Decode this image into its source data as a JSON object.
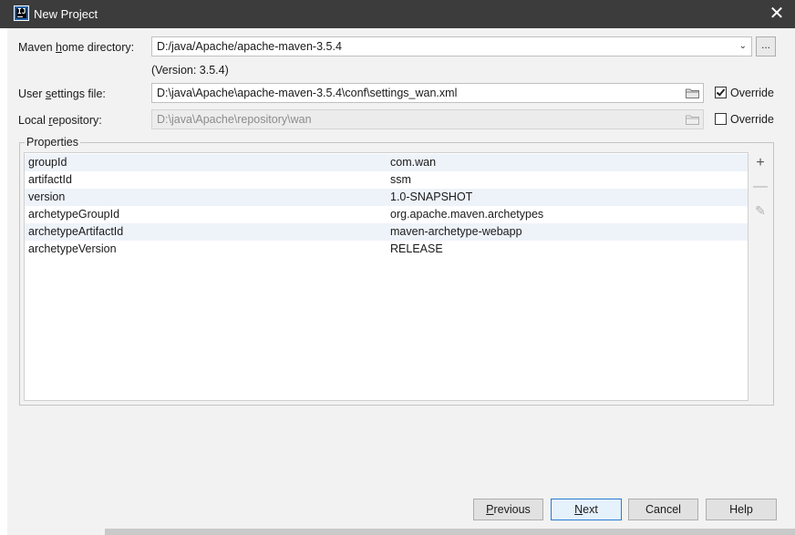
{
  "window": {
    "title": "New Project"
  },
  "maven_home": {
    "label_pre": "Maven ",
    "label_mnemonic": "h",
    "label_post": "ome directory:",
    "value": "D:/java/Apache/apache-maven-3.5.4",
    "browse_label": "...",
    "version_text": "(Version: 3.5.4)"
  },
  "user_settings": {
    "label_pre": "User ",
    "label_mnemonic": "s",
    "label_post": "ettings file:",
    "value": "D:\\java\\Apache\\apache-maven-3.5.4\\conf\\settings_wan.xml",
    "override_label": "Override",
    "override_checked": true
  },
  "local_repo": {
    "label_pre": "Local ",
    "label_mnemonic": "r",
    "label_post": "epository:",
    "value": "D:\\java\\Apache\\repository\\wan",
    "override_label": "Override",
    "override_checked": false
  },
  "properties": {
    "title": "Properties",
    "rows": [
      {
        "key": "groupId",
        "value": "com.wan"
      },
      {
        "key": "artifactId",
        "value": "ssm"
      },
      {
        "key": "version",
        "value": "1.0-SNAPSHOT"
      },
      {
        "key": "archetypeGroupId",
        "value": "org.apache.maven.archetypes"
      },
      {
        "key": "archetypeArtifactId",
        "value": "maven-archetype-webapp"
      },
      {
        "key": "archetypeVersion",
        "value": "RELEASE"
      }
    ]
  },
  "buttons": {
    "previous_mnemonic": "P",
    "previous_rest": "revious",
    "next_mnemonic": "N",
    "next_rest": "ext",
    "cancel": "Cancel",
    "help": "Help"
  },
  "colors": {
    "titlebar": "#3c3c3c",
    "dialog_bg": "#f2f2f2",
    "default_button_border": "#2a7ad4",
    "alt_row": "#eef3fa"
  },
  "icons": [
    "intellij-icon",
    "close-icon",
    "chevron-down-icon",
    "folder-icon",
    "checkmark-icon",
    "plus-icon",
    "minus-icon",
    "pencil-icon"
  ]
}
